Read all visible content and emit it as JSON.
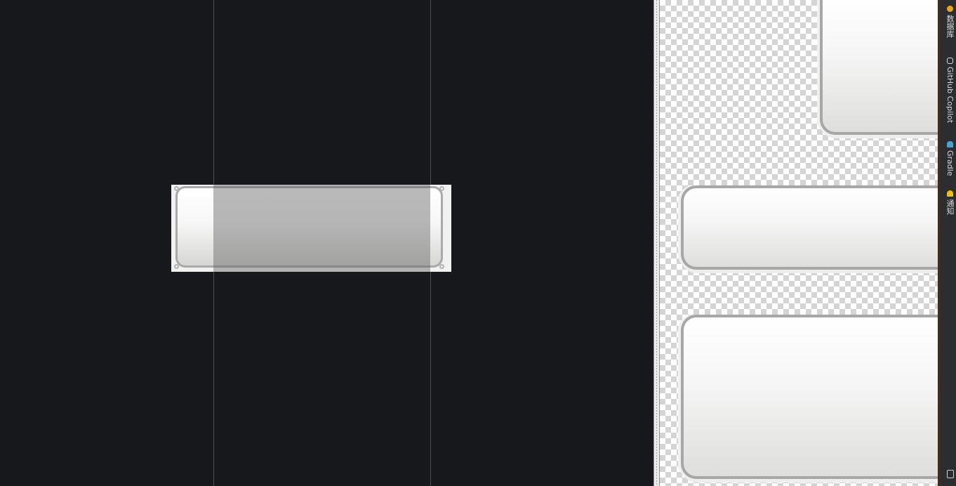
{
  "editor": {
    "background": "#17181c",
    "stretch_overlay_color": "#5a5a5a",
    "button_border_color": "#a9a9a9"
  },
  "preview": {
    "checker_light": "#ffffff",
    "checker_dark": "#d4d4d4"
  },
  "tool_strip": {
    "background": "#2b2d30",
    "items": [
      {
        "label": "数据库",
        "icon": "database-icon",
        "icon_color": "#f0a30a"
      },
      {
        "label": "GitHub Copilot",
        "icon": "copilot-icon",
        "icon_color": "#d9d9d9"
      },
      {
        "label": "Gradle",
        "icon": "gradle-icon",
        "icon_color": "#3fa7d6"
      },
      {
        "label": "通知",
        "icon": "bell-icon",
        "icon_color": "#f0c000"
      }
    ],
    "bottom_icon": "terminal-icon"
  }
}
